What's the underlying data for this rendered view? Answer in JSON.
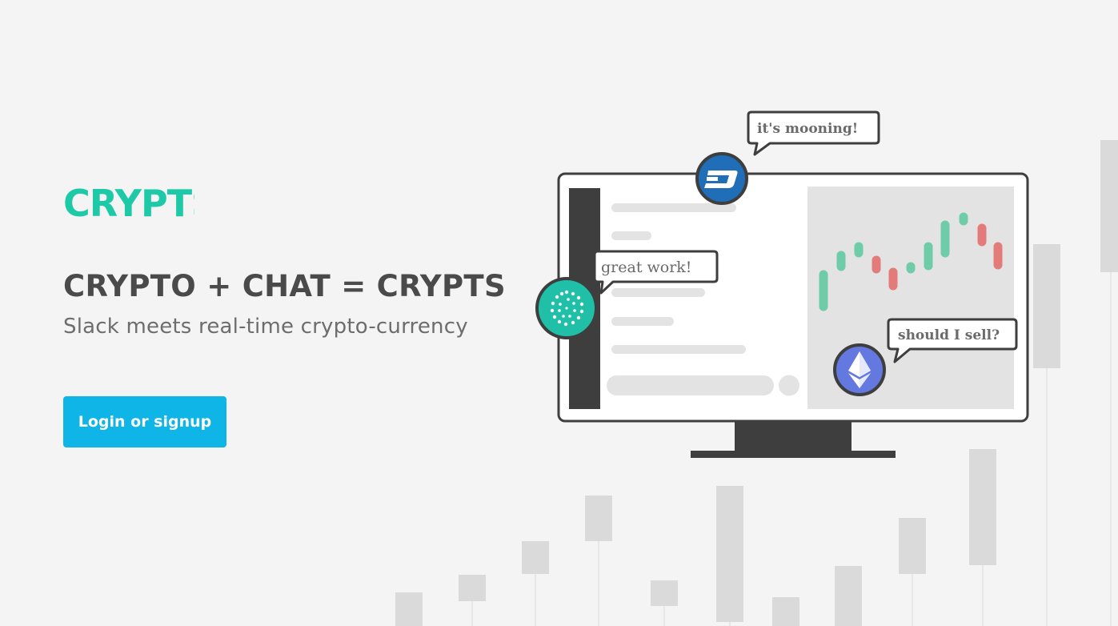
{
  "brand": {
    "logo_text": "CRYPTS",
    "accent_color": "#1ec9a7"
  },
  "hero": {
    "headline": "CRYPTO + CHAT = CRYPTS",
    "subline": "Slack meets real-time crypto-currency",
    "cta_label": "Login or signup",
    "cta_color": "#0eb5e6"
  },
  "illustration": {
    "bubbles": {
      "dash": "it's mooning!",
      "iota": "great work!",
      "eth": "should I sell?"
    },
    "coins": {
      "dash_icon": "dash-coin-icon",
      "iota_icon": "iota-coin-icon",
      "eth_icon": "ethereum-coin-icon"
    },
    "colors": {
      "up_candle": "#6fcca8",
      "down_candle": "#e37b7b",
      "frame": "#3e3e3e",
      "dash": "#1f6eb7",
      "iota": "#1fbfa8",
      "eth": "#6479e0"
    }
  }
}
